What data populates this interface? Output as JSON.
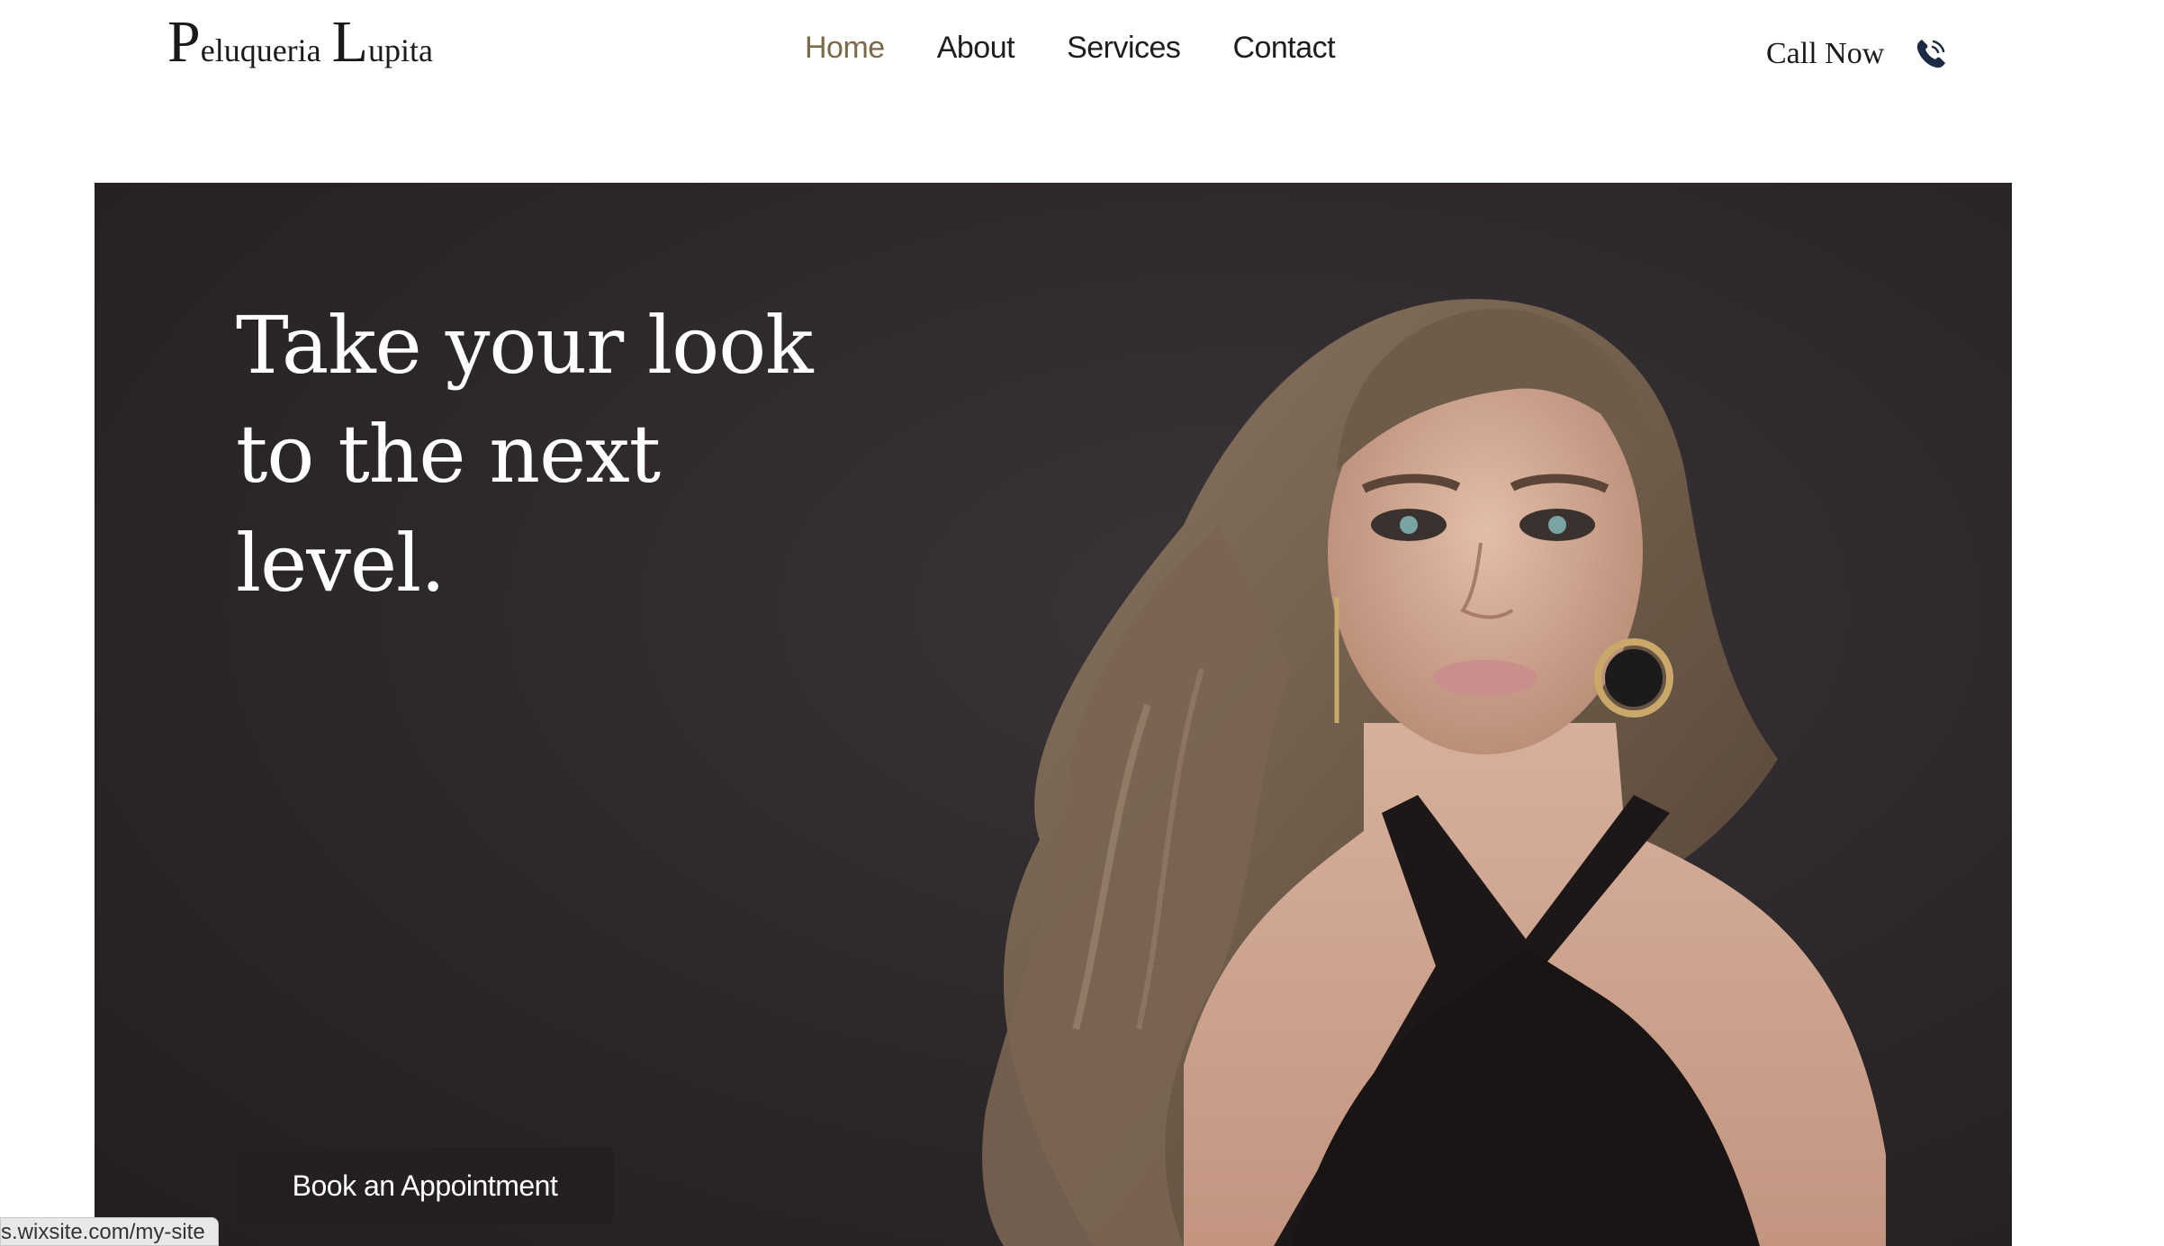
{
  "header": {
    "logo": {
      "cap1": "P",
      "rest1": "eluqueria",
      "cap2": "L",
      "rest2": "upita"
    },
    "nav": [
      {
        "label": "Home",
        "active": true
      },
      {
        "label": "About",
        "active": false
      },
      {
        "label": "Services",
        "active": false
      },
      {
        "label": "Contact",
        "active": false
      }
    ],
    "call": {
      "label": "Call Now",
      "icon": "phone-icon"
    }
  },
  "hero": {
    "title": "Take your look to the next level.",
    "button_label": "Book an Appointment",
    "image": "woman-long-wavy-hair-photo"
  },
  "status": {
    "url": "s.wixsite.com/my-site"
  },
  "colors": {
    "nav_active": "#7a6a4a",
    "hero_bg": "#2c2729",
    "button_bg": "#242022",
    "phone_icon": "#1c2a44"
  }
}
